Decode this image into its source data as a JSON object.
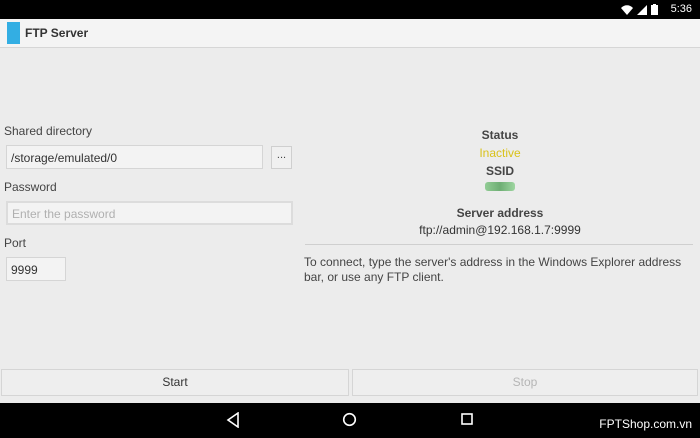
{
  "status_bar": {
    "time": "5:36",
    "icons": [
      "wifi-icon",
      "signal-icon",
      "battery-icon"
    ]
  },
  "app": {
    "title": "FTP Server"
  },
  "form": {
    "shared_directory_label": "Shared directory",
    "shared_directory_value": "/storage/emulated/0",
    "browse_label": "...",
    "password_label": "Password",
    "password_placeholder": "Enter the password",
    "port_label": "Port",
    "port_value": "9999"
  },
  "info": {
    "status_label": "Status",
    "status_value": "Inactive",
    "ssid_label": "SSID",
    "server_address_label": "Server address",
    "server_address_value": "ftp://admin@192.168.1.7:9999",
    "help_text": "To connect, type the server's address in the Windows Explorer address bar, or use any FTP client."
  },
  "buttons": {
    "start": "Start",
    "stop": "Stop"
  },
  "nav": {
    "icons": [
      "back-icon",
      "home-icon",
      "recents-icon"
    ]
  },
  "watermark": "FPTShop.com.vn",
  "colors": {
    "accent": "#33aee3",
    "inactive": "#d9c21a",
    "disabled_text": "#b5b5b5"
  }
}
